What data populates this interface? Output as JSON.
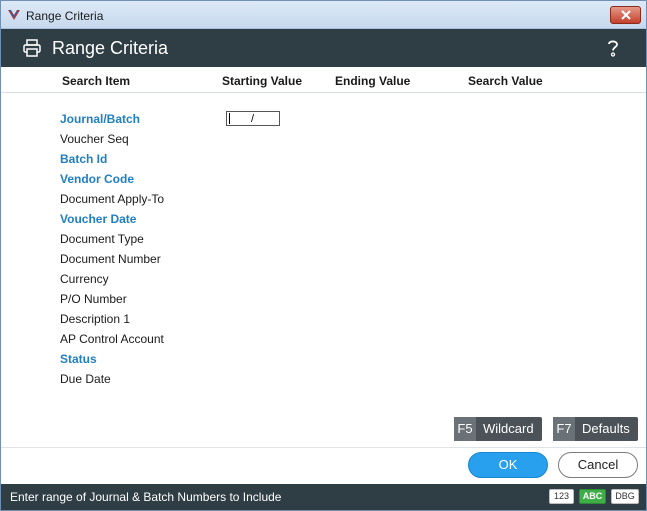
{
  "window": {
    "title": "Range Criteria"
  },
  "header": {
    "title": "Range Criteria"
  },
  "columns": {
    "search_item": "Search Item",
    "starting_value": "Starting Value",
    "ending_value": "Ending Value",
    "search_value": "Search Value"
  },
  "items": [
    {
      "label": "Journal/Batch",
      "key": true
    },
    {
      "label": "Voucher Seq",
      "key": false
    },
    {
      "label": "Batch Id",
      "key": true
    },
    {
      "label": "Vendor Code",
      "key": true
    },
    {
      "label": "Document Apply-To",
      "key": false
    },
    {
      "label": "Voucher Date",
      "key": true
    },
    {
      "label": "Document Type",
      "key": false
    },
    {
      "label": "Document Number",
      "key": false
    },
    {
      "label": "Currency",
      "key": false
    },
    {
      "label": "P/O Number",
      "key": false
    },
    {
      "label": "Description 1",
      "key": false
    },
    {
      "label": "AP Control Account",
      "key": false
    },
    {
      "label": "Status",
      "key": true
    },
    {
      "label": "Due Date",
      "key": false
    }
  ],
  "starting_value_input": {
    "value": "/"
  },
  "fkeys": {
    "wildcard": {
      "key": "F5",
      "label": "Wildcard"
    },
    "defaults": {
      "key": "F7",
      "label": "Defaults"
    }
  },
  "buttons": {
    "ok": "OK",
    "cancel": "Cancel"
  },
  "status": {
    "text": "Enter range of Journal & Batch Numbers to Include",
    "badges": [
      "123",
      "ABC",
      "DBG"
    ]
  },
  "colors": {
    "header_bg": "#2f3d44",
    "key_item": "#1f7fc2",
    "ok_button": "#28a0ee",
    "badge_green": "#3fae49"
  }
}
